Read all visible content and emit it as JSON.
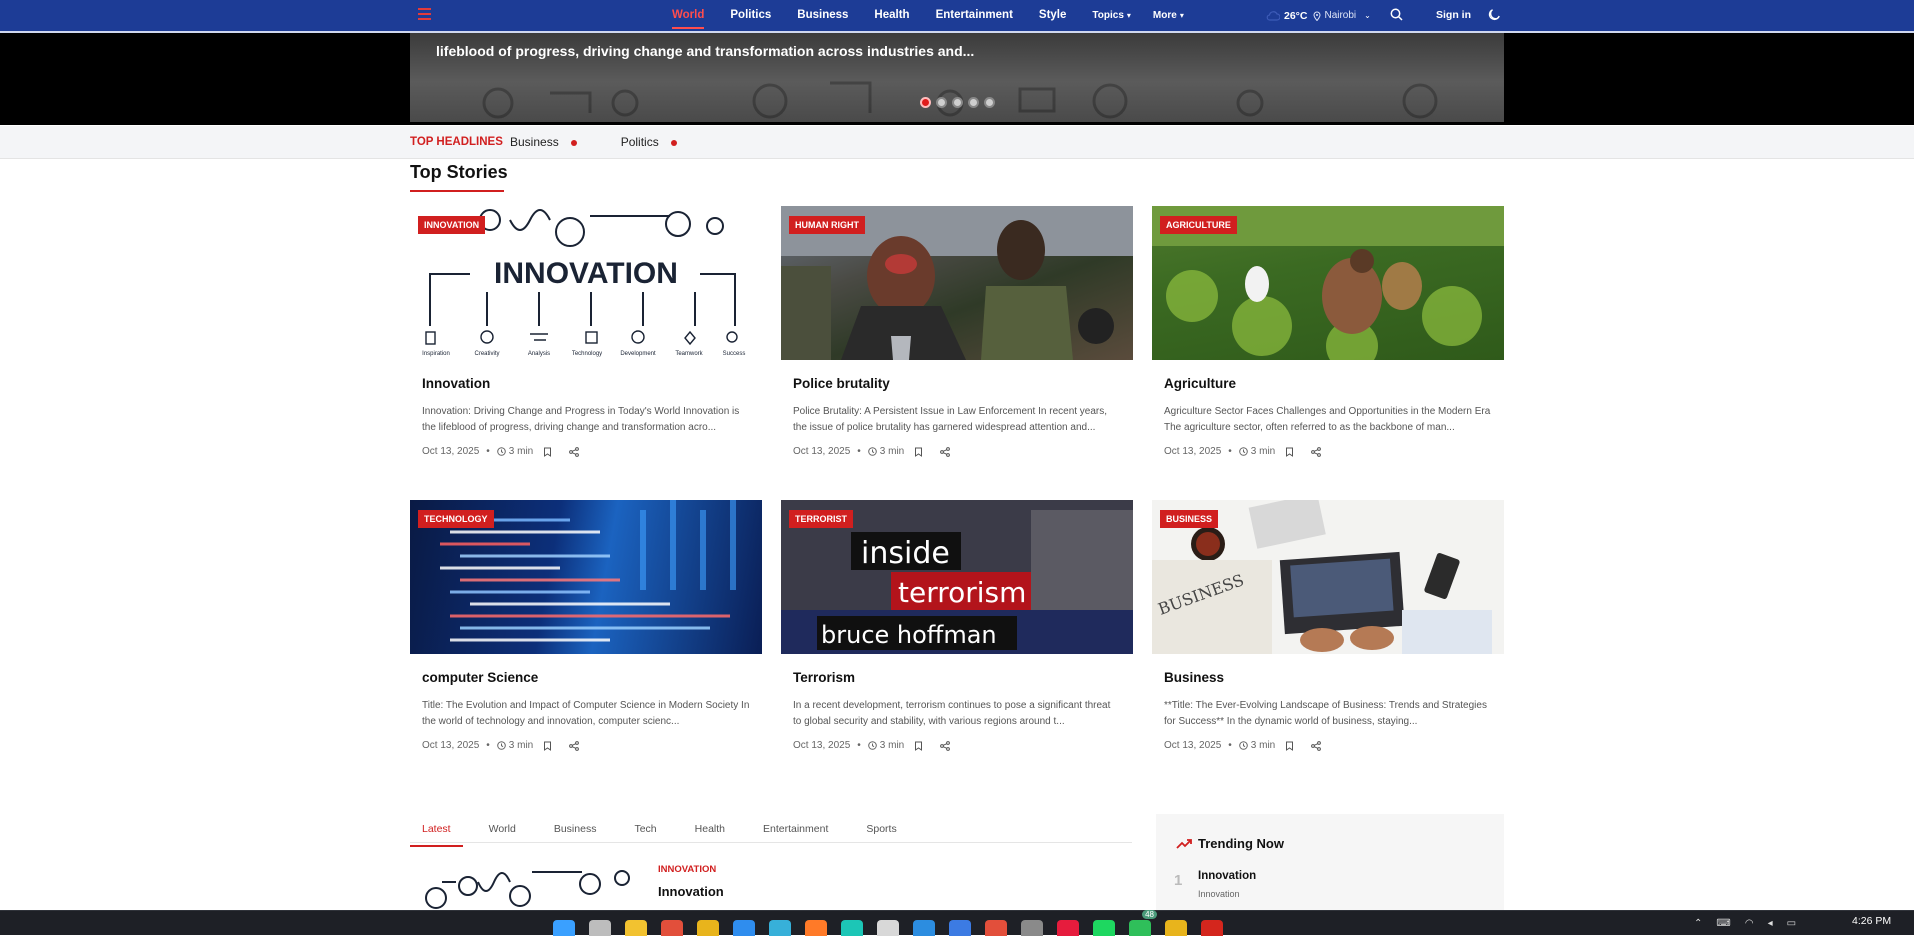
{
  "nav": {
    "links": [
      {
        "label": "World",
        "active": true
      },
      {
        "label": "Politics"
      },
      {
        "label": "Business"
      },
      {
        "label": "Health"
      },
      {
        "label": "Entertainment"
      },
      {
        "label": "Style"
      }
    ],
    "topics_label": "Topics",
    "more_label": "More",
    "weather": {
      "temp": "26°C",
      "city": "Nairobi"
    },
    "signin_label": "Sign in"
  },
  "hero": {
    "text": "lifeblood of progress, driving change and transformation across industries and...",
    "slide_count": 5,
    "active_slide": 1
  },
  "ticker": {
    "label": "TOP HEADLINES",
    "items": [
      "Business",
      "Politics"
    ]
  },
  "top_stories": {
    "title": "Top Stories",
    "cards": [
      {
        "category": "INNOVATION",
        "title": "Innovation",
        "excerpt": "Innovation: Driving Change and Progress in Today's World Innovation is the lifeblood of progress, driving change and transformation acro...",
        "date": "Oct 13, 2025",
        "read": "3 min"
      },
      {
        "category": "HUMAN RIGHT",
        "title": "Police brutality",
        "excerpt": "Police Brutality: A Persistent Issue in Law Enforcement In recent years, the issue of police brutality has garnered widespread attention and...",
        "date": "Oct 13, 2025",
        "read": "3 min"
      },
      {
        "category": "AGRICULTURE",
        "title": "Agriculture",
        "excerpt": "Agriculture Sector Faces Challenges and Opportunities in the Modern Era The agriculture sector, often referred to as the backbone of man...",
        "date": "Oct 13, 2025",
        "read": "3 min"
      },
      {
        "category": "TECHNOLOGY",
        "title": "computer Science",
        "excerpt": "Title: The Evolution and Impact of Computer Science in Modern Society In the world of technology and innovation, computer scienc...",
        "date": "Oct 13, 2025",
        "read": "3 min"
      },
      {
        "category": "TERRORIST",
        "title": "Terrorism",
        "excerpt": "In a recent development, terrorism continues to pose a significant threat to global security and stability, with various regions around t...",
        "date": "Oct 13, 2025",
        "read": "3 min"
      },
      {
        "category": "BUSINESS",
        "title": "Business",
        "excerpt": "**Title: The Ever-Evolving Landscape of Business: Trends and Strategies for Success** In the dynamic world of business, staying...",
        "date": "Oct 13, 2025",
        "read": "3 min"
      }
    ]
  },
  "innovation_image": {
    "word": "INNOVATION",
    "steps": [
      "Inspiration",
      "Creativity",
      "Analysis",
      "Technology",
      "Development",
      "Teamwork",
      "Success"
    ]
  },
  "terror_image": {
    "lines": [
      "inside",
      "terrorism",
      "bruce hoffman"
    ]
  },
  "business_image": {
    "paper": "BUSINESS"
  },
  "tabs": [
    "Latest",
    "World",
    "Business",
    "Tech",
    "Health",
    "Entertainment",
    "Sports"
  ],
  "latest": {
    "category": "INNOVATION",
    "title": "Innovation"
  },
  "trending": {
    "title": "Trending Now",
    "items": [
      {
        "rank": "1",
        "title": "Innovation",
        "category": "Innovation"
      }
    ]
  },
  "taskbar": {
    "time": "4:26 PM",
    "badge": "48",
    "colors": {
      "bg": "#1e2026",
      "nav": "#1d3c96",
      "accent": "#d11f1f"
    }
  }
}
